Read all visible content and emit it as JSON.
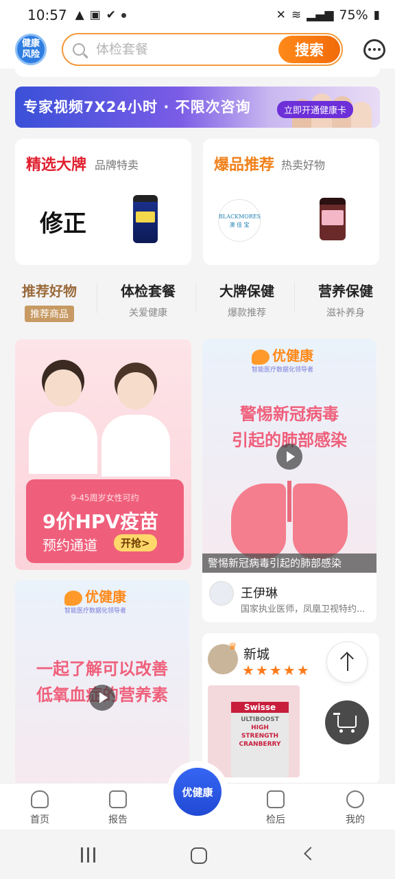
{
  "status_bar": {
    "time": "10:57",
    "battery": "75%"
  },
  "header": {
    "logo_line1": "健康",
    "logo_line2": "风险",
    "search_placeholder": "体检套餐",
    "search_button": "搜索"
  },
  "banner": {
    "text": "专家视频7X24小时 · 不限次咨询",
    "cta": "立即开通健康卡"
  },
  "brand_cards": [
    {
      "title": "精选大牌",
      "subtitle": "品牌特卖",
      "title_color": "#e0202f"
    },
    {
      "title": "爆品推荐",
      "subtitle": "热卖好物",
      "title_color": "#f0801a"
    }
  ],
  "brand_logos": {
    "seal_text": "修正",
    "blackmores": "BLACKMORES",
    "blackmores_cn": "澳 佳 宝"
  },
  "categories": [
    {
      "title": "推荐好物",
      "sub": "推荐商品"
    },
    {
      "title": "体检套餐",
      "sub": "关爱健康"
    },
    {
      "title": "大牌保健",
      "sub": "爆款推荐"
    },
    {
      "title": "营养保健",
      "sub": "滋补养身"
    }
  ],
  "hpv_card": {
    "tagline": "9-45周岁女性可约",
    "headline": "9价HPV疫苗",
    "sub": "预约通道",
    "cta": "开抢>"
  },
  "video1": {
    "brand": "优健康",
    "brand_tagline": "智能医疗数据化领导者",
    "title_line1": "警惕新冠病毒",
    "title_line2": "引起的肺部感染",
    "caption": "警惕新冠病毒引起的肺部感染",
    "author": "王伊琳",
    "author_desc": "国家执业医师，凤凰卫视特约..."
  },
  "video2": {
    "brand": "优健康",
    "brand_tagline": "智能医疗数据化领导者",
    "title_line1": "一起了解可以改善",
    "title_line2": "低氧血症的营养素"
  },
  "post": {
    "author": "新城",
    "stars": "★★★★★",
    "product_brand": "Swisse",
    "product_line": "ULTIBOOST",
    "product_name": "HIGH STRENGTH CRANBERRY"
  },
  "tabbar": [
    {
      "label": "首页"
    },
    {
      "label": "报告"
    },
    {
      "label": "优健康"
    },
    {
      "label": "检后"
    },
    {
      "label": "我的"
    }
  ],
  "colors": {
    "accent_orange": "#f26a0a",
    "brand_blue": "#2f5ee0",
    "pink": "#ef5f7b"
  }
}
